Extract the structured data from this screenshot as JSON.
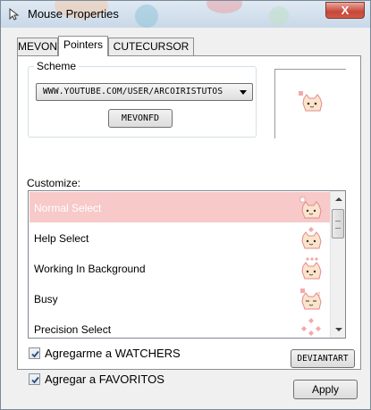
{
  "window": {
    "title": "Mouse Properties",
    "close_label": "X"
  },
  "tabs": [
    {
      "label": "MEVON",
      "active": false
    },
    {
      "label": "Pointers",
      "active": true
    },
    {
      "label": "CUTECURSOR",
      "active": false
    }
  ],
  "scheme": {
    "group_label": "Scheme",
    "selected_value": "WWW.YOUTUBE.COM/USER/ARCOIRISTUTOS",
    "button_label": "MEVONFD"
  },
  "customize": {
    "label": "Customize:",
    "items": [
      {
        "label": "Normal Select",
        "icon": "cat-cursor-icon",
        "selected": true
      },
      {
        "label": "Help Select",
        "icon": "cat-help-cursor-icon",
        "selected": false
      },
      {
        "label": "Working In Background",
        "icon": "cat-working-cursor-icon",
        "selected": false
      },
      {
        "label": "Busy",
        "icon": "cat-busy-cursor-icon",
        "selected": false
      },
      {
        "label": "Precision Select",
        "icon": "cat-precision-cursor-icon",
        "selected": false
      }
    ]
  },
  "options": {
    "watchers_label": "Agregarme a WATCHERS",
    "watchers_checked": true,
    "favoritos_label": "Agregar a FAVORITOS",
    "favoritos_checked": true,
    "deviantart_label": "DEVIANTART"
  },
  "footer": {
    "apply_label": "Apply"
  },
  "colors": {
    "selected_row": "#f7c9c9",
    "cat_fill": "#fbe3cc",
    "cat_outline": "#e28b8b"
  }
}
